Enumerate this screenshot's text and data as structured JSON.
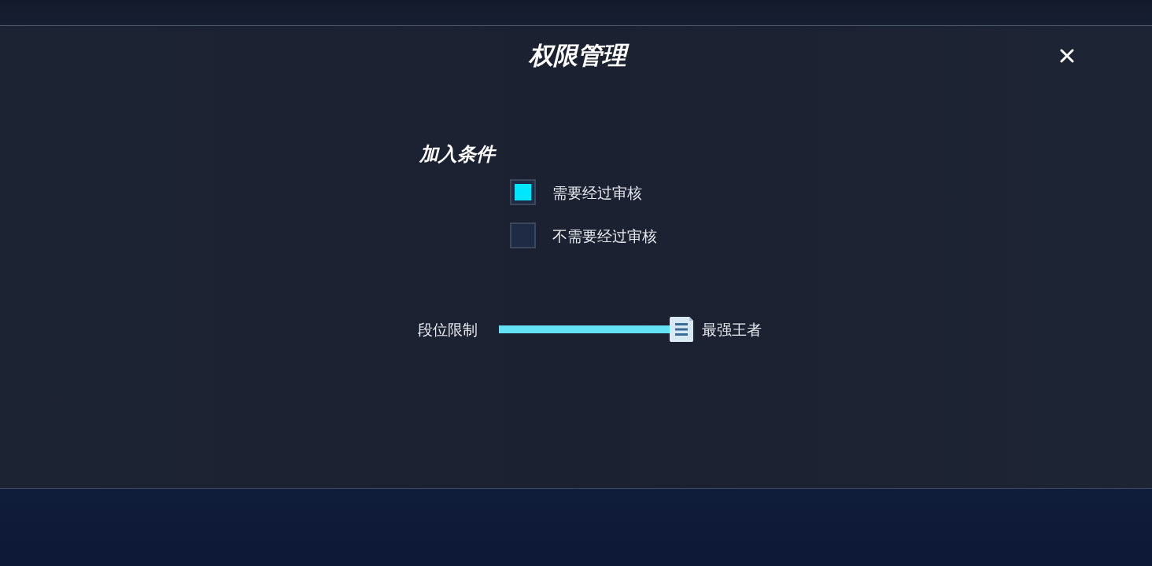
{
  "dialog": {
    "title": "权限管理"
  },
  "join_conditions": {
    "heading": "加入条件",
    "options": [
      {
        "label": "需要经过审核",
        "selected": true
      },
      {
        "label": "不需要经过审核",
        "selected": false
      }
    ]
  },
  "rank_limit": {
    "label": "段位限制",
    "level": 1,
    "value": "最强王者"
  }
}
